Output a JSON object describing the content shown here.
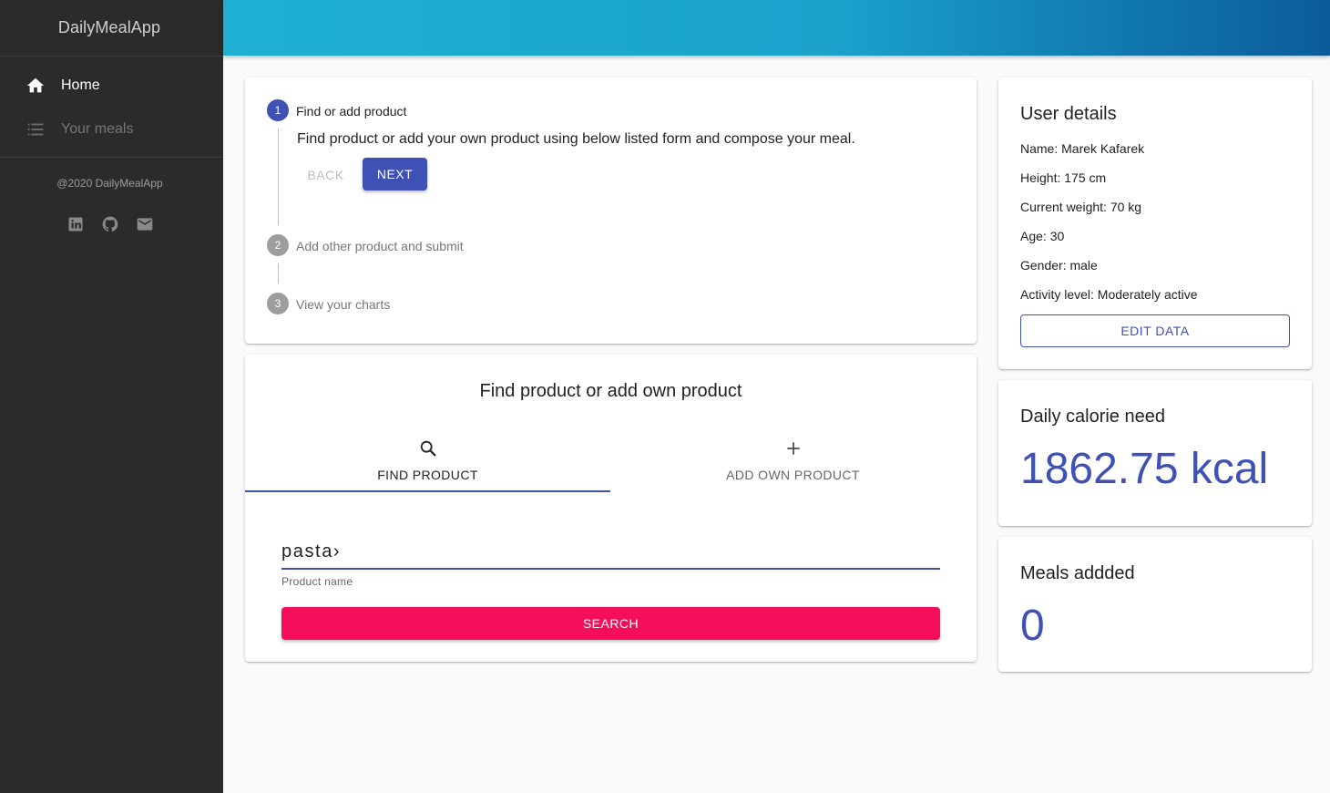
{
  "app": {
    "title": "DailyMealApp"
  },
  "sidebar": {
    "items": [
      {
        "label": "Home",
        "icon": "home-icon",
        "active": true
      },
      {
        "label": "Your meals",
        "icon": "list-icon",
        "active": false
      }
    ],
    "copyright": "@2020 DailyMealApp",
    "social_icons": [
      "linkedin-icon",
      "github-icon",
      "email-icon"
    ]
  },
  "stepper": {
    "steps": [
      {
        "number": "1",
        "label": "Find or add product",
        "active": true
      },
      {
        "number": "2",
        "label": "Add other product and submit",
        "active": false
      },
      {
        "number": "3",
        "label": "View your charts",
        "active": false
      }
    ],
    "description": "Find product or add your own product using below listed form and compose your meal.",
    "back_label": "BACK",
    "next_label": "NEXT"
  },
  "find_product": {
    "title": "Find product or add own product",
    "tabs": [
      {
        "label": "FIND PRODUCT",
        "icon": "search-icon",
        "active": true
      },
      {
        "label": "ADD OWN PRODUCT",
        "icon": "plus-icon",
        "active": false
      }
    ],
    "input_value": "pasta›",
    "helper_text": "Product name",
    "search_label": "SEARCH"
  },
  "user_details": {
    "title": "User details",
    "rows": [
      "Name: Marek Kafarek",
      "Height: 175 cm",
      "Current weight: 70 kg",
      "Age: 30",
      "Gender: male",
      "Activity level: Moderately active"
    ],
    "edit_label": "EDIT DATA"
  },
  "calorie": {
    "title": "Daily calorie need",
    "value": "1862.75 kcal"
  },
  "meals": {
    "title": "Meals addded",
    "value": "0"
  },
  "colors": {
    "primary": "#3f51b5",
    "accent": "#f50f5a",
    "sidebar_bg": "#2b2b2b"
  }
}
